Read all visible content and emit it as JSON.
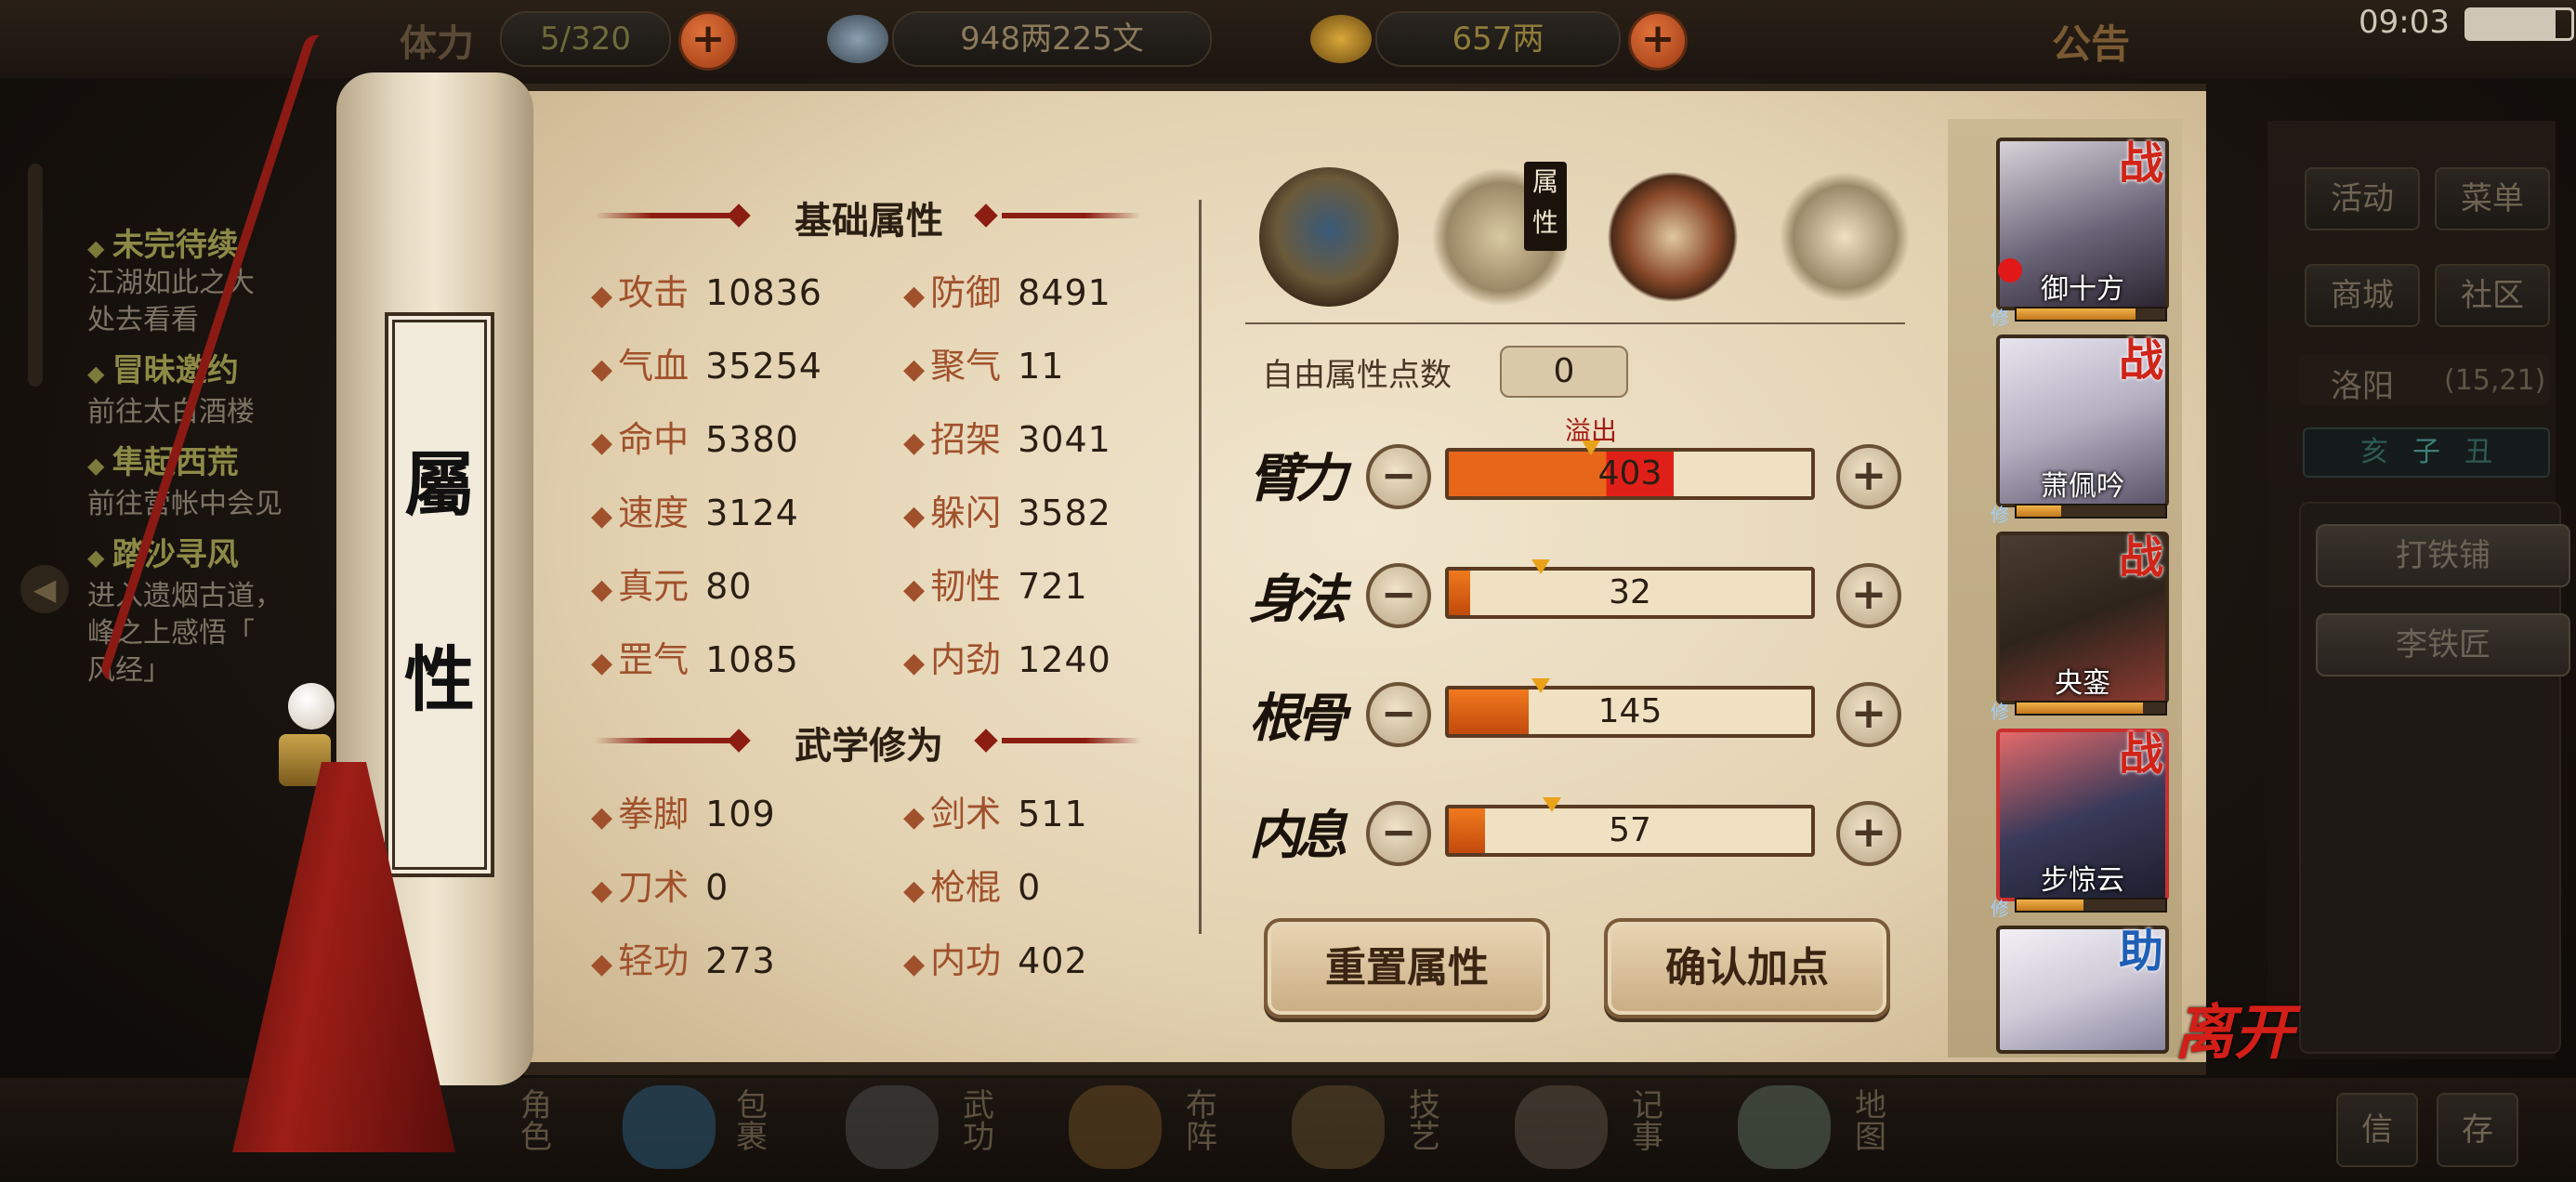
{
  "status_bar": {
    "time": "09:03"
  },
  "top_bar": {
    "partial_label": "体力",
    "stamina": "5/320",
    "silver": "948两225文",
    "gold": "657两",
    "announcement": "公告"
  },
  "quests": [
    {
      "title": "未完待续",
      "desc": [
        "江湖如此之大",
        "处去看看"
      ]
    },
    {
      "title": "冒昧邀约",
      "desc": [
        "前往太白酒楼"
      ]
    },
    {
      "title": "隼起西荒",
      "desc": [
        "前往营帐中会见"
      ]
    },
    {
      "title": "踏沙寻风",
      "desc": [
        "进入遗烟古道，",
        "峰之上感悟「",
        "风经」"
      ]
    }
  ],
  "right_menu": {
    "buttons": [
      "活动",
      "菜单",
      "商城",
      "社区"
    ],
    "location": "洛阳",
    "coords": "(15,21)",
    "time_chars": [
      "亥",
      "子",
      "丑"
    ],
    "npcs": [
      "打铁铺",
      "李铁匠"
    ]
  },
  "scroll": {
    "title_chars": [
      "屬",
      "性"
    ]
  },
  "basic_attributes": {
    "title": "基础属性",
    "stats": [
      {
        "label": "攻击",
        "value": "10836"
      },
      {
        "label": "防御",
        "value": "8491"
      },
      {
        "label": "气血",
        "value": "35254"
      },
      {
        "label": "聚气",
        "value": "11"
      },
      {
        "label": "命中",
        "value": "5380"
      },
      {
        "label": "招架",
        "value": "3041"
      },
      {
        "label": "速度",
        "value": "3124"
      },
      {
        "label": "躲闪",
        "value": "3582"
      },
      {
        "label": "真元",
        "value": "80"
      },
      {
        "label": "韧性",
        "value": "721"
      },
      {
        "label": "罡气",
        "value": "1085"
      },
      {
        "label": "内劲",
        "value": "1240"
      }
    ]
  },
  "martial_cultivation": {
    "title": "武学修为",
    "stats": [
      {
        "label": "拳脚",
        "value": "109"
      },
      {
        "label": "剑术",
        "value": "511"
      },
      {
        "label": "刀术",
        "value": "0"
      },
      {
        "label": "枪棍",
        "value": "0"
      },
      {
        "label": "轻功",
        "value": "273"
      },
      {
        "label": "内功",
        "value": "402"
      }
    ]
  },
  "tabs": {
    "active_label": "属性"
  },
  "allocation": {
    "free_points_label": "自由属性点数",
    "free_points": "0",
    "overflow_label": "溢出",
    "attributes": [
      {
        "name": "臂力",
        "value": "403",
        "fill": 0.62,
        "overflow": true
      },
      {
        "name": "身法",
        "value": "32",
        "fill": 0.06,
        "overflow": false
      },
      {
        "name": "根骨",
        "value": "145",
        "fill": 0.22,
        "overflow": false
      },
      {
        "name": "内息",
        "value": "57",
        "fill": 0.1,
        "overflow": false
      }
    ],
    "reset_button": "重置属性",
    "confirm_button": "确认加点"
  },
  "party": [
    {
      "name": "御十方",
      "role": "战",
      "xp": 0.8
    },
    {
      "name": "萧佩吟",
      "role": "战",
      "xp": 0.3
    },
    {
      "name": "央銮",
      "role": "战",
      "xp": 0.85
    },
    {
      "name": "步惊云",
      "role": "战",
      "xp": 0.45
    },
    {
      "name": "",
      "role": "助",
      "xp": 0.0
    }
  ],
  "xp_tag": "修",
  "leave_button": "离开",
  "bottom_nav": [
    "角色",
    "包裹",
    "武功",
    "布阵",
    "技艺",
    "记事",
    "地图"
  ],
  "bottom_right": [
    "信",
    "存"
  ],
  "colors": {
    "accent_red": "#8b1d12",
    "bar_orange": "#e8661a",
    "overflow_red": "#e02018"
  }
}
